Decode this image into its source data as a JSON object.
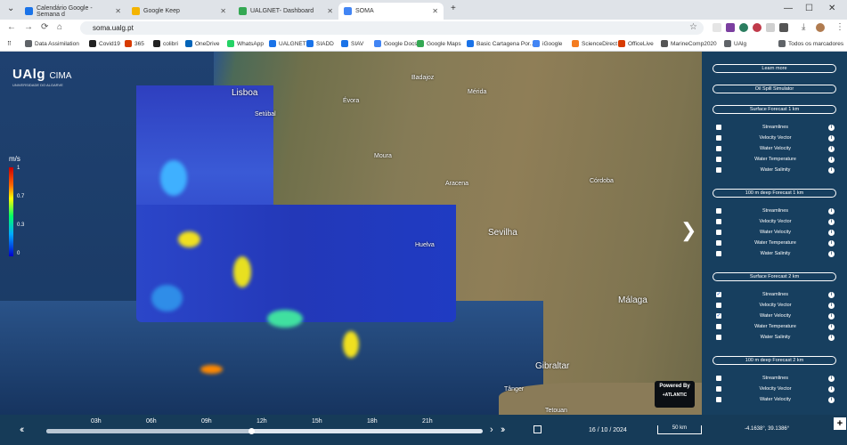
{
  "browser": {
    "tabs": [
      {
        "title": "Calendário Google - Semana d",
        "color": "#1a73e8"
      },
      {
        "title": "Google Keep",
        "color": "#f4b400"
      },
      {
        "title": "UALGNET- Dashboard",
        "color": "#34a853"
      },
      {
        "title": "SOMA",
        "color": "#4285f4"
      }
    ],
    "new_tab": "+",
    "url": "soma.ualg.pt",
    "bookmarks": [
      {
        "label": "Data Assimilation",
        "color": "#5f6368"
      },
      {
        "label": "Covid19",
        "color": "#222222"
      },
      {
        "label": "365",
        "color": "#d83b01"
      },
      {
        "label": "colibri",
        "color": "#222222"
      },
      {
        "label": "OneDrive",
        "color": "#0364b8"
      },
      {
        "label": "WhatsApp",
        "color": "#25d366"
      },
      {
        "label": "UALGNET",
        "color": "#1a73e8"
      },
      {
        "label": "SIADD",
        "color": "#1a73e8"
      },
      {
        "label": "SIAV",
        "color": "#1a73e8"
      },
      {
        "label": "Google Docs",
        "color": "#4285f4"
      },
      {
        "label": "Google Maps",
        "color": "#34a853"
      },
      {
        "label": "Basic Cartagena Por...",
        "color": "#1a73e8"
      },
      {
        "label": "iGoogle",
        "color": "#4285f4"
      },
      {
        "label": "ScienceDirect",
        "color": "#f47c20"
      },
      {
        "label": "OfficeLive",
        "color": "#d83b01"
      },
      {
        "label": "MarineComp2020",
        "color": "#555555"
      },
      {
        "label": "UAlg",
        "color": "#5f6368"
      }
    ],
    "all_bookmarks": "Todos os marcadores"
  },
  "logo": {
    "main": "UAlg",
    "suffix": "CIMA",
    "sub": "UNIVERSIDADE DO ALGARVE"
  },
  "colorbar": {
    "title": "m/s",
    "ticks": [
      "1",
      "0.7",
      "0.3",
      "0"
    ]
  },
  "map_labels": {
    "lisboa": "Lisboa",
    "setubal": "Setúbal",
    "badajoz": "Badajoz",
    "merida": "Mérida",
    "sevilha": "Sevilha",
    "cordoba": "Córdoba",
    "huelva": "Huelva",
    "malaga": "Málaga",
    "gibraltar": "Gibraltar",
    "tanger": "Tânger",
    "tetouan": "Tetouan",
    "aracena": "Aracena",
    "moura": "Moura",
    "evora": "Évora"
  },
  "panel": {
    "learn_more": "Learn more",
    "oil_spill": "Oil Spill Simulator",
    "sections": [
      {
        "title": "Surface Forecast 1 km",
        "items": [
          {
            "label": "Streamlines",
            "checked": false
          },
          {
            "label": "Velocity Vector",
            "checked": false
          },
          {
            "label": "Water Velocity",
            "checked": false
          },
          {
            "label": "Water Temperature",
            "checked": false
          },
          {
            "label": "Water Salinity",
            "checked": false
          }
        ]
      },
      {
        "title": "100 m deep Forecast 1 km",
        "items": [
          {
            "label": "Streamlines",
            "checked": false
          },
          {
            "label": "Velocity Vector",
            "checked": false
          },
          {
            "label": "Water Velocity",
            "checked": false
          },
          {
            "label": "Water Temperature",
            "checked": false
          },
          {
            "label": "Water Salinity",
            "checked": false
          }
        ]
      },
      {
        "title": "Surface Forecast 2 km",
        "items": [
          {
            "label": "Streamlines",
            "checked": true
          },
          {
            "label": "Velocity Vector",
            "checked": false
          },
          {
            "label": "Water Velocity",
            "checked": true
          },
          {
            "label": "Water Temperature",
            "checked": false
          },
          {
            "label": "Water Salinity",
            "checked": false
          }
        ]
      },
      {
        "title": "100 m deep Forecast 2 km",
        "items": [
          {
            "label": "Streamlines",
            "checked": false
          },
          {
            "label": "Velocity Vector",
            "checked": false
          },
          {
            "label": "Water Velocity",
            "checked": false
          }
        ]
      }
    ]
  },
  "powered_by": {
    "line1": "Powered By",
    "line2": "+ATLANTIC"
  },
  "timeline": {
    "hours": [
      "03h",
      "06h",
      "09h",
      "12h",
      "15h",
      "18h",
      "21h"
    ],
    "progress": 0.47,
    "date": "16 / 10 / 2024",
    "scale": "50 km",
    "coords": "-4.1638°, 39.1386°",
    "zoom_in": "+"
  }
}
